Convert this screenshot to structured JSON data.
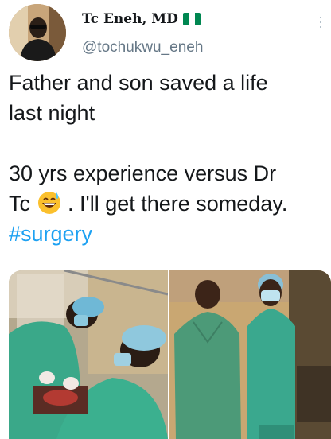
{
  "tweet": {
    "display_name": "Tc Eneh, MD",
    "handle": "@tochukwu_eneh",
    "line1": "Father and son saved a life",
    "line2": "last night",
    "line3": "30 yrs experience versus Dr",
    "line4_pre": "Tc",
    "line4_post": ". I'll get there someday.",
    "hashtag": "#surgery"
  },
  "icons": {
    "flag": "nigeria-flag-icon",
    "emoji": "grinning-sweat-emoji-icon",
    "more": "more-options-icon"
  },
  "colors": {
    "text": "#14171a",
    "secondary": "#657786",
    "link": "#1da1f2",
    "flag_green": "#008751"
  }
}
